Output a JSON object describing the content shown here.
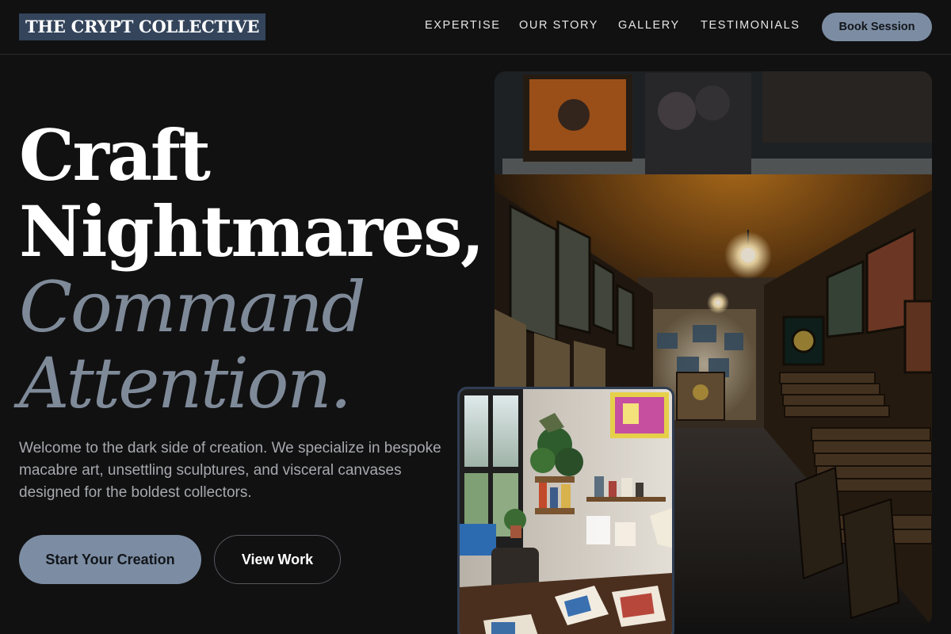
{
  "header": {
    "logo": "THE CRYPT COLLECTIVE",
    "nav": [
      {
        "label": "EXPERTISE"
      },
      {
        "label": "OUR STORY"
      },
      {
        "label": "GALLERY"
      },
      {
        "label": "TESTIMONIALS"
      }
    ],
    "cta": "Book Session"
  },
  "hero": {
    "headline": {
      "line1": "Craft",
      "line2": "Nightmares,",
      "line3": "Command",
      "line4": "Attention."
    },
    "intro": "Welcome to the dark side of creation. We specialize in bespoke macabre art, unsettling sculptures, and visceral canvases designed for the boldest collectors.",
    "primary_button": "Start Your Creation",
    "secondary_button": "View Work"
  },
  "colors": {
    "background": "#111112",
    "accent": "#7c8da3",
    "headline_accent": "#7f8a99",
    "logo_bg": "#33445b"
  },
  "images": {
    "main": "art-gallery-corridor-photo",
    "inset": "artist-studio-photo"
  }
}
